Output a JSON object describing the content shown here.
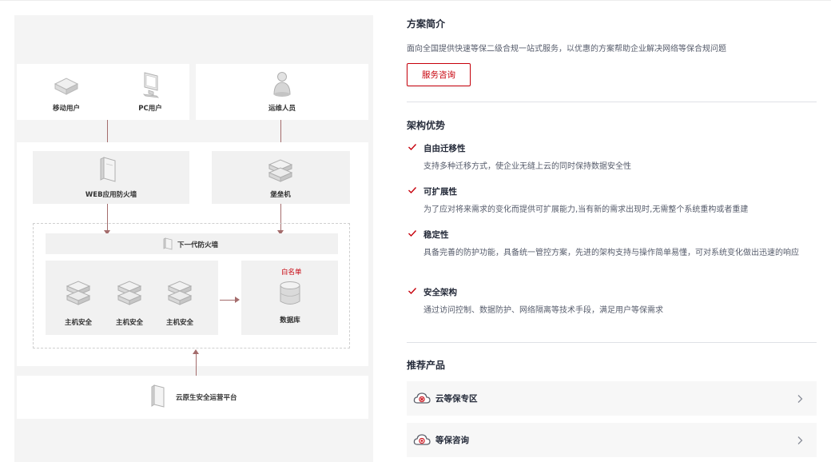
{
  "diagram": {
    "mobile_user": "移动用户",
    "pc_user": "PC用户",
    "ops_staff": "运维人员",
    "waf": "WEB应用防火墙",
    "bastion": "堡垒机",
    "ngfw": "下一代防火墙",
    "host_security_1": "主机安全",
    "host_security_2": "主机安全",
    "host_security_3": "主机安全",
    "whitelist": "白名单",
    "database": "数据库",
    "cloud_platform": "云原生安全运营平台",
    "accent_color": "#a46c6c"
  },
  "overview": {
    "title": "方案简介",
    "description": "面向全国提供快速等保二级合规一站式服务，以优惠的方案帮助企业解决网络等保合规问题",
    "consult_button": "服务咨询"
  },
  "advantages": {
    "title": "架构优势",
    "items": [
      {
        "title": "自由迁移性",
        "desc": "支持多种迁移方式，使企业无缝上云的同时保持数据安全性"
      },
      {
        "title": "可扩展性",
        "desc": "为了应对将来需求的变化而提供可扩展能力,当有新的需求出现时,无需整个系统重构或者重建"
      },
      {
        "title": "稳定性",
        "desc": "具备完善的防护功能，具备统一管控方案，先进的架构支持与操作简单易懂，可对系统变化做出迅速的响应"
      },
      {
        "title": "安全架构",
        "desc": "通过访问控制、数据防护、网络隔离等技术手段，满足用户等保需求"
      }
    ]
  },
  "products": {
    "title": "推荐产品",
    "items": [
      {
        "name": "云等保专区"
      },
      {
        "name": "等保咨询"
      }
    ]
  },
  "colors": {
    "brand_red": "#c7000b",
    "text_primary": "#252b3a",
    "text_secondary": "#575d6c"
  }
}
